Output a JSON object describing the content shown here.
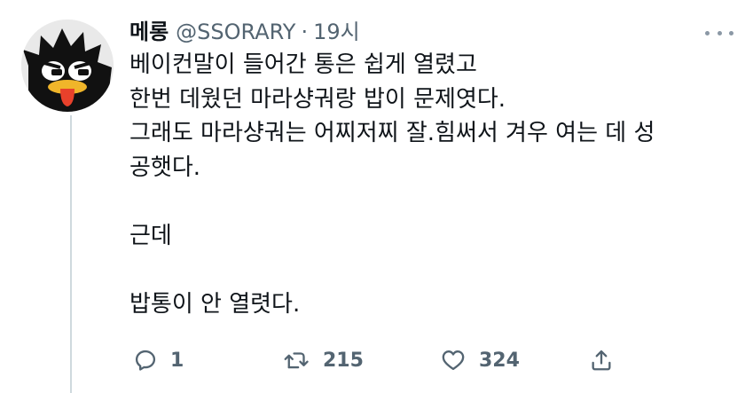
{
  "tweet": {
    "author_name": "메롱",
    "handle": "@SSORARY",
    "separator": "·",
    "time": "19시",
    "text": "베이컨말이 들어간 통은 쉽게 열렸고\n한번 데웠던 마라샹궈랑 밥이 문제엿다.\n그래도 마라샹궈는 어찌저찌 잘.힘써서 겨우 여는 데 성\n공햇다.\n\n근데\n\n밥통이 안 열렷다.",
    "reply_count": "1",
    "retweet_count": "215",
    "like_count": "324"
  },
  "icons": {
    "more": "more-horizontal-icon",
    "reply": "reply-icon",
    "retweet": "retweet-icon",
    "like": "heart-icon",
    "share": "share-icon"
  },
  "colors": {
    "text_primary": "#0f1419",
    "text_secondary": "#536471",
    "divider": "#cfd9de"
  }
}
